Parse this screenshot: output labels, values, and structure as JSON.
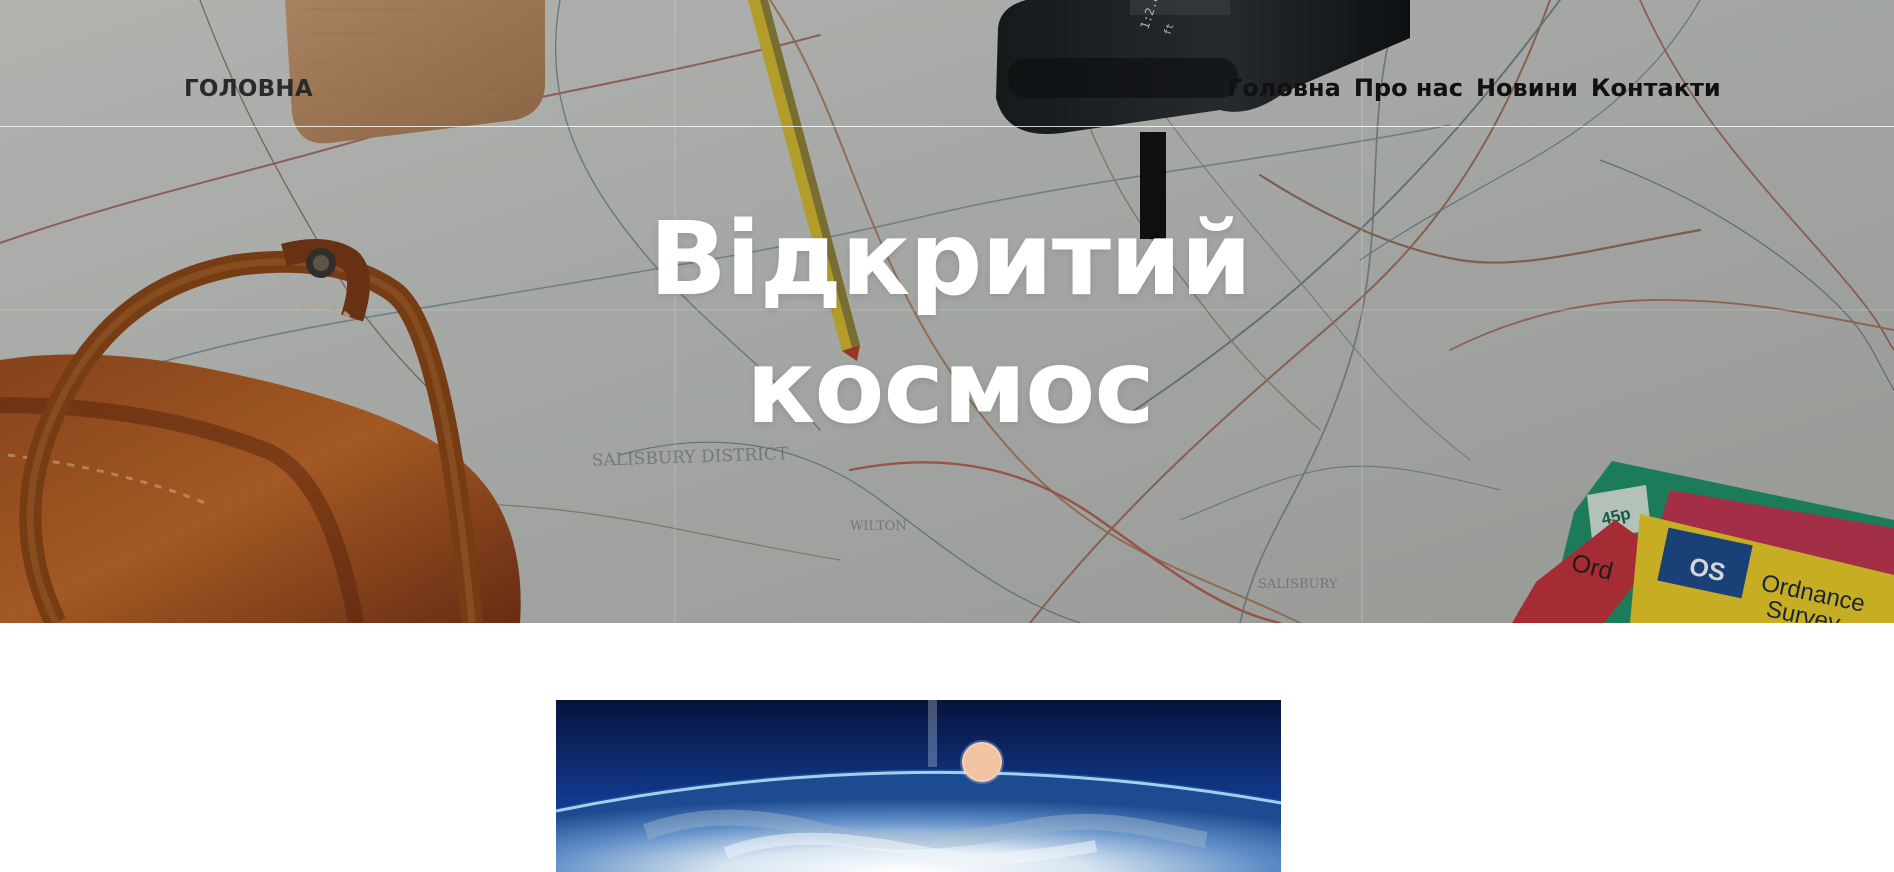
{
  "header": {
    "brand": "ГОЛОВНА",
    "nav": [
      "Головна",
      "Про нас",
      "Новини",
      "Контакти"
    ]
  },
  "hero": {
    "title_line_1": "Відкритий",
    "title_line_2": "космос",
    "background": {
      "map_text": [
        "SALISBURY DISTRICT",
        "WILTON",
        "SALISBURY",
        "45p",
        "Ordnance",
        "Survey",
        "OS"
      ]
    }
  },
  "content": {
    "image_alt": "Earth from space"
  },
  "colors": {
    "hero_text": "#ffffff",
    "nav_text": "#111111",
    "brand_text": "#2a2a2a",
    "page_background": "#ffffff",
    "space_blue": "#0b1a43"
  }
}
